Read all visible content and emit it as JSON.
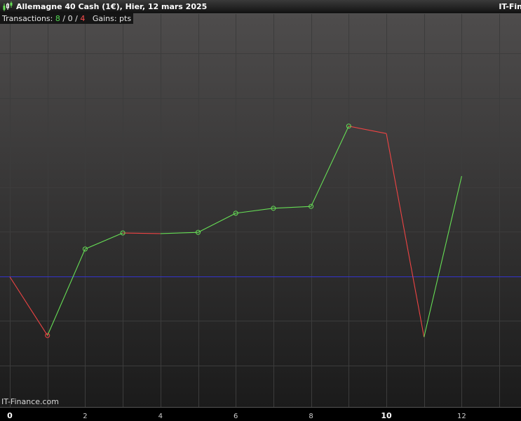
{
  "window": {
    "title": "Allemagne 40 Cash (1€), Hier, 12 mars 2025",
    "brand_top": "IT-Fin",
    "watermark": "IT-Finance.com"
  },
  "infobar": {
    "transactions_label": "Transactions:",
    "wins": "8",
    "neutral": "0",
    "losses": "4",
    "separator": "/",
    "gains_label": "Gains: pts"
  },
  "colors": {
    "background_top": "#4e4c4c",
    "background_bottom": "#1b1b1b",
    "gain": "#66dd55",
    "loss": "#ee4444",
    "baseline": "#3333cc",
    "grid": "#3c3c3c"
  },
  "chart_data": {
    "type": "line",
    "title": "Allemagne 40 Cash (1€), Hier, 12 mars 2025",
    "xlabel": "",
    "ylabel": "",
    "x": [
      0,
      1,
      2,
      3,
      4,
      5,
      6,
      7,
      8,
      9,
      10,
      11,
      12
    ],
    "y": [
      0,
      -95,
      45,
      71,
      70,
      72,
      103,
      111,
      114,
      244,
      232,
      -97.5,
      163
    ],
    "segment_result": [
      "loss",
      "gain",
      "gain",
      "loss",
      "gain",
      "gain",
      "gain",
      "gain",
      "gain",
      "loss",
      "loss",
      "gain"
    ],
    "marker_result": [
      null,
      "loss",
      "gain",
      "gain",
      null,
      "gain",
      "gain",
      "gain",
      "gain",
      "gain",
      null,
      null,
      null
    ],
    "baseline": 0,
    "xlim": [
      0,
      13.5
    ],
    "x_ticks": [
      {
        "value": 0,
        "label": "0",
        "bold": true
      },
      {
        "value": 2,
        "label": "2",
        "bold": false
      },
      {
        "value": 4,
        "label": "4",
        "bold": false
      },
      {
        "value": 6,
        "label": "6",
        "bold": false
      },
      {
        "value": 8,
        "label": "8",
        "bold": false
      },
      {
        "value": 10,
        "label": "10",
        "bold": true
      },
      {
        "value": 12,
        "label": "12",
        "bold": false
      }
    ],
    "grid": true
  }
}
